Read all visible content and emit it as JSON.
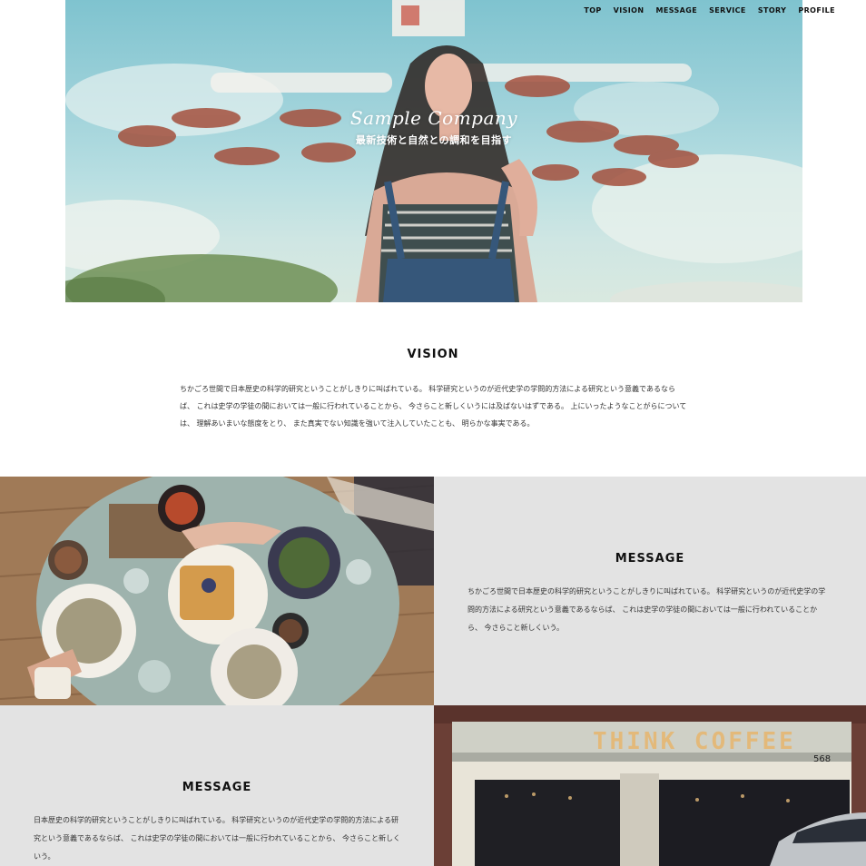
{
  "nav": {
    "items": [
      {
        "label": "TOP"
      },
      {
        "label": "VISION"
      },
      {
        "label": "MESSAGE"
      },
      {
        "label": "SERVICE"
      },
      {
        "label": "STORY"
      },
      {
        "label": "PROFILE"
      }
    ]
  },
  "hero": {
    "logo": "Sample Company",
    "tagline": "最新技術と自然との調和を目指す"
  },
  "vision": {
    "title": "VISION",
    "body": "ちかごろ世間で日本歴史の科学的研究ということがしきりに叫ばれている。 科学研究というのが近代史学の学問的方法による研究という意義であるならば、 これは史学の学徒の間においては一般に行われていることから、 今さらこと新しくいうには及ばないはずである。 上にいったようなことがらについては、 理解あいまいな態度をとり、 また真実でない知識を強いて注入していたことも、 明らかな事実である。"
  },
  "message1": {
    "title": "MESSAGE",
    "body": "ちかごろ世間で日本歴史の科学的研究ということがしきりに叫ばれている。 科学研究というのが近代史学の学問的方法による研究という意義であるならば、 これは史学の学徒の間においては一般に行われていることから、 今さらこと新しくいう。"
  },
  "message2": {
    "title": "MESSAGE",
    "body": "日本歴史の科学的研究ということがしきりに叫ばれている。 科学研究というのが近代史学の学問的方法による研究という意義であるならば、 これは史学の学徒の間においては一般に行われていることから、 今さらこと新しくいう。"
  },
  "storefront": {
    "sign": "THINK COFFEE",
    "number": "568"
  }
}
